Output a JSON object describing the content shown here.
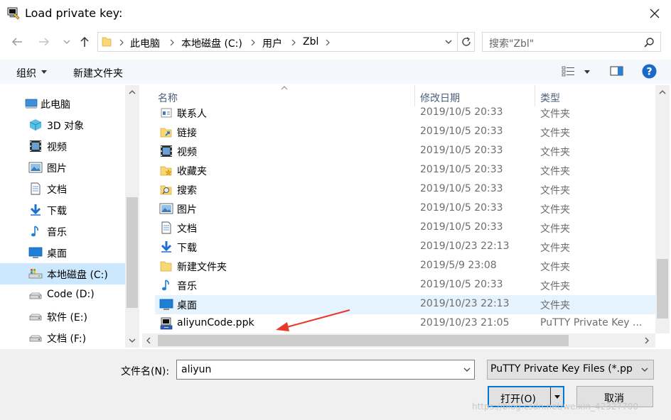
{
  "window": {
    "title": "Load private key:",
    "close_label": "×"
  },
  "address": {
    "crumbs": [
      "此电脑",
      "本地磁盘 (C:)",
      "用户",
      "Zbl"
    ]
  },
  "search": {
    "placeholder": "搜索\"Zbl\""
  },
  "toolbar": {
    "organize": "组织",
    "new_folder": "新建文件夹"
  },
  "nav": {
    "items": [
      {
        "label": "此电脑",
        "icon": "computer-icon"
      },
      {
        "label": "3D 对象",
        "icon": "cube-icon"
      },
      {
        "label": "视频",
        "icon": "video-icon"
      },
      {
        "label": "图片",
        "icon": "picture-icon"
      },
      {
        "label": "文档",
        "icon": "document-icon"
      },
      {
        "label": "下载",
        "icon": "download-icon"
      },
      {
        "label": "音乐",
        "icon": "music-icon"
      },
      {
        "label": "桌面",
        "icon": "desktop-icon"
      },
      {
        "label": "本地磁盘 (C:)",
        "icon": "system-drive-icon"
      },
      {
        "label": "Code (D:)",
        "icon": "drive-icon"
      },
      {
        "label": "软件 (E:)",
        "icon": "drive-icon"
      },
      {
        "label": "文档 (F:)",
        "icon": "drive-icon"
      }
    ]
  },
  "columns": {
    "name": "名称",
    "date": "修改日期",
    "type": "类型"
  },
  "files": [
    {
      "name": "联系人",
      "date": "2019/10/5 20:33",
      "type": "文件夹",
      "icon": "contacts-icon"
    },
    {
      "name": "链接",
      "date": "2019/10/5 20:33",
      "type": "文件夹",
      "icon": "links-icon"
    },
    {
      "name": "视频",
      "date": "2019/10/5 20:33",
      "type": "文件夹",
      "icon": "video-icon"
    },
    {
      "name": "收藏夹",
      "date": "2019/10/5 20:33",
      "type": "文件夹",
      "icon": "favorites-icon"
    },
    {
      "name": "搜索",
      "date": "2019/10/5 20:33",
      "type": "文件夹",
      "icon": "search-folder-icon"
    },
    {
      "name": "图片",
      "date": "2019/10/5 20:33",
      "type": "文件夹",
      "icon": "picture-icon"
    },
    {
      "name": "文档",
      "date": "2019/10/5 20:33",
      "type": "文件夹",
      "icon": "document-icon"
    },
    {
      "name": "下载",
      "date": "2019/10/23 22:13",
      "type": "文件夹",
      "icon": "download-icon"
    },
    {
      "name": "新建文件夹",
      "date": "2019/5/9 23:08",
      "type": "文件夹",
      "icon": "folder-icon"
    },
    {
      "name": "音乐",
      "date": "2019/10/5 20:33",
      "type": "文件夹",
      "icon": "music-icon"
    },
    {
      "name": "桌面",
      "date": "2019/10/23 22:13",
      "type": "文件夹",
      "icon": "desktop-icon"
    },
    {
      "name": "aliyunCode.ppk",
      "date": "2019/10/23 21:05",
      "type": "PuTTY Private Key ...",
      "icon": "putty-key-icon"
    }
  ],
  "bottom": {
    "filename_label": "文件名(N):",
    "filename_value": "aliyun",
    "filter": "PuTTY Private Key Files (*.pp",
    "open": "打开(O)",
    "cancel": "取消"
  },
  "watermark": "https://blog.csdn.net/weixin_42327700",
  "colors": {
    "accent": "#0078d7",
    "selected": "#cce8ff",
    "hover": "#e5f3ff",
    "arrow": "#e8392b",
    "folder": "#f8d775"
  }
}
